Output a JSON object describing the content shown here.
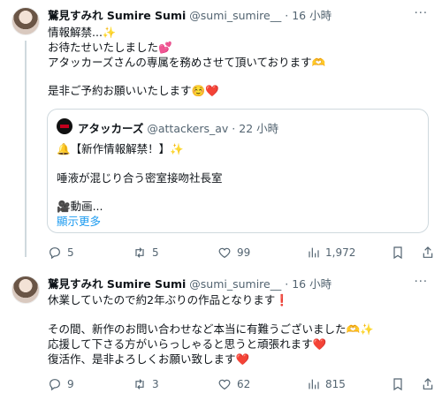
{
  "tweet1": {
    "name": "鷲見すみれ Sumire Sumi",
    "handle": "@sumi_sumire__",
    "dot": "·",
    "time": "16 小時",
    "more": "···",
    "lines": [
      "情報解禁...✨",
      "お待たせいたしました💕",
      "アタッカーズさんの専属を務めさせて頂いております🫶",
      "",
      "是非ご予約お願いいたします☺️❤️"
    ],
    "quote": {
      "name": "アタッカーズ",
      "handle": "@attackers_av",
      "dot": "·",
      "time": "22 小時",
      "line1": "🔔【新作情報解禁！】✨",
      "line2": "唾液が混じり合う密室接吻社長室",
      "line3": "🎥動画...",
      "show_more": "顯示更多"
    },
    "actions": {
      "reply": "5",
      "retweet": "5",
      "like": "99",
      "views": "1,972"
    }
  },
  "tweet2": {
    "name": "鷲見すみれ Sumire Sumi",
    "handle": "@sumi_sumire__",
    "dot": "·",
    "time": "16 小時",
    "more": "···",
    "lines": [
      "休業していたので約2年ぶりの作品となります❗",
      "",
      "その間、新作のお問い合わせなど本当に有難うございました🫶✨",
      "応援して下さる方がいらっしゃると思うと頑張れます❤️",
      "復活作、是非よろしくお願い致します❤️"
    ],
    "actions": {
      "reply": "9",
      "retweet": "3",
      "like": "62",
      "views": "815"
    }
  },
  "colors": {
    "accent": "#1d9bf0",
    "muted": "#536471",
    "heart": "#f91880"
  }
}
